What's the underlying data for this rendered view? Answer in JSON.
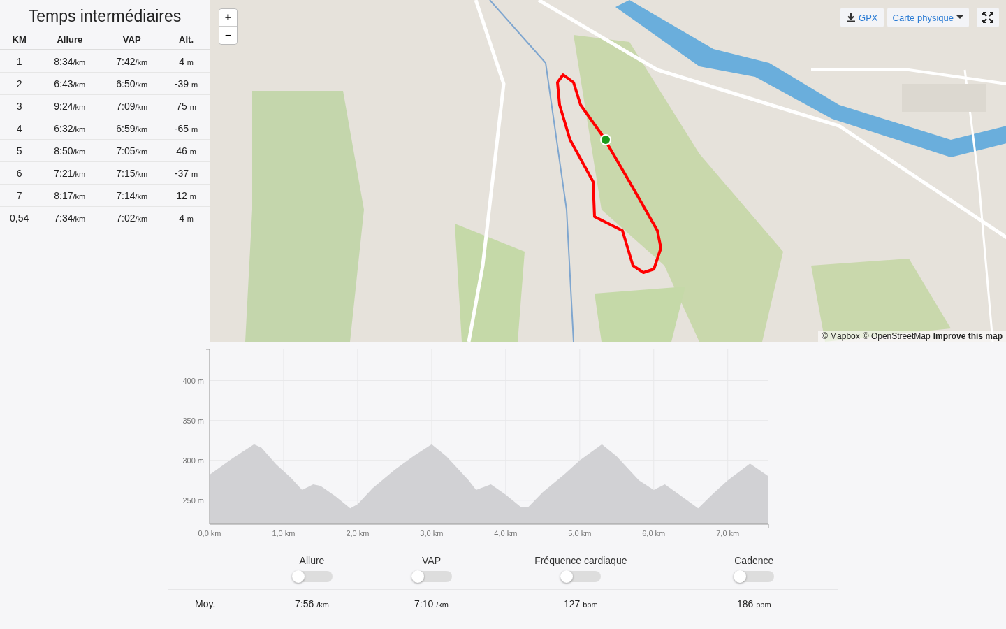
{
  "splits": {
    "title": "Temps intermédiaires",
    "columns": [
      "KM",
      "Allure",
      "VAP",
      "Alt."
    ],
    "rows": [
      {
        "km": "1",
        "pace": "8:34",
        "pace_unit": "/km",
        "gap": "7:42",
        "gap_unit": "/km",
        "alt": "4",
        "alt_unit": "m"
      },
      {
        "km": "2",
        "pace": "6:43",
        "pace_unit": "/km",
        "gap": "6:50",
        "gap_unit": "/km",
        "alt": "-39",
        "alt_unit": "m"
      },
      {
        "km": "3",
        "pace": "9:24",
        "pace_unit": "/km",
        "gap": "7:09",
        "gap_unit": "/km",
        "alt": "75",
        "alt_unit": "m"
      },
      {
        "km": "4",
        "pace": "6:32",
        "pace_unit": "/km",
        "gap": "6:59",
        "gap_unit": "/km",
        "alt": "-65",
        "alt_unit": "m"
      },
      {
        "km": "5",
        "pace": "8:50",
        "pace_unit": "/km",
        "gap": "7:05",
        "gap_unit": "/km",
        "alt": "46",
        "alt_unit": "m"
      },
      {
        "km": "6",
        "pace": "7:21",
        "pace_unit": "/km",
        "gap": "7:15",
        "gap_unit": "/km",
        "alt": "-37",
        "alt_unit": "m"
      },
      {
        "km": "7",
        "pace": "8:17",
        "pace_unit": "/km",
        "gap": "7:14",
        "gap_unit": "/km",
        "alt": "12",
        "alt_unit": "m"
      },
      {
        "km": "0,54",
        "pace": "7:34",
        "pace_unit": "/km",
        "gap": "7:02",
        "gap_unit": "/km",
        "alt": "4",
        "alt_unit": "m"
      }
    ]
  },
  "map": {
    "kind": "picture",
    "zoom_in": "+",
    "zoom_out": "−",
    "gpx_button": "GPX",
    "layer_dropdown": "Carte physique",
    "attribution": {
      "mapbox": "© Mapbox",
      "osm": "© OpenStreetMap",
      "improve": "Improve this map"
    }
  },
  "elevation": {
    "chart_data": {
      "type": "area",
      "x": [
        0,
        0.3,
        0.6,
        0.7,
        0.9,
        1.1,
        1.25,
        1.4,
        1.5,
        1.7,
        1.9,
        2.0,
        2.2,
        2.5,
        2.75,
        3.0,
        3.2,
        3.5,
        3.6,
        3.8,
        4.0,
        4.2,
        4.3,
        4.5,
        4.8,
        5.0,
        5.3,
        5.5,
        5.8,
        6.0,
        6.15,
        6.3,
        6.6,
        6.8,
        7.0,
        7.3,
        7.55
      ],
      "grid": true,
      "series": [
        {
          "color": "#d1d1d4",
          "values": [
            282,
            302,
            320,
            316,
            295,
            278,
            263,
            270,
            268,
            255,
            240,
            245,
            265,
            288,
            305,
            320,
            305,
            275,
            263,
            270,
            257,
            242,
            241,
            260,
            283,
            300,
            320,
            305,
            275,
            263,
            270,
            260,
            240,
            258,
            275,
            296,
            280
          ]
        }
      ],
      "xlim": [
        0,
        7.55
      ],
      "ylim": [
        220,
        439
      ],
      "xticks": [
        {
          "value": 0,
          "label": "0,0 km"
        },
        {
          "value": 1,
          "label": "1,0 km"
        },
        {
          "value": 2,
          "label": "2,0 km"
        },
        {
          "value": 3,
          "label": "3,0 km"
        },
        {
          "value": 4,
          "label": "4,0 km"
        },
        {
          "value": 5,
          "label": "5,0 km"
        },
        {
          "value": 6,
          "label": "6,0 km"
        },
        {
          "value": 7,
          "label": "7,0 km"
        }
      ],
      "yticks": [
        {
          "value": 250,
          "label": "250 m"
        },
        {
          "value": 300,
          "label": "300 m"
        },
        {
          "value": 350,
          "label": "350 m"
        },
        {
          "value": 400,
          "label": "400 m"
        }
      ]
    }
  },
  "toggles": [
    {
      "label": "Allure",
      "on": false
    },
    {
      "label": "VAP",
      "on": false
    },
    {
      "label": "Fréquence cardiaque",
      "on": false
    },
    {
      "label": "Cadence",
      "on": false
    }
  ],
  "averages": {
    "label": "Moy.",
    "values": [
      {
        "value": "7:56",
        "unit": "/km"
      },
      {
        "value": "7:10",
        "unit": "/km"
      },
      {
        "value": "127",
        "unit": "bpm"
      },
      {
        "value": "186",
        "unit": "ppm"
      }
    ]
  }
}
